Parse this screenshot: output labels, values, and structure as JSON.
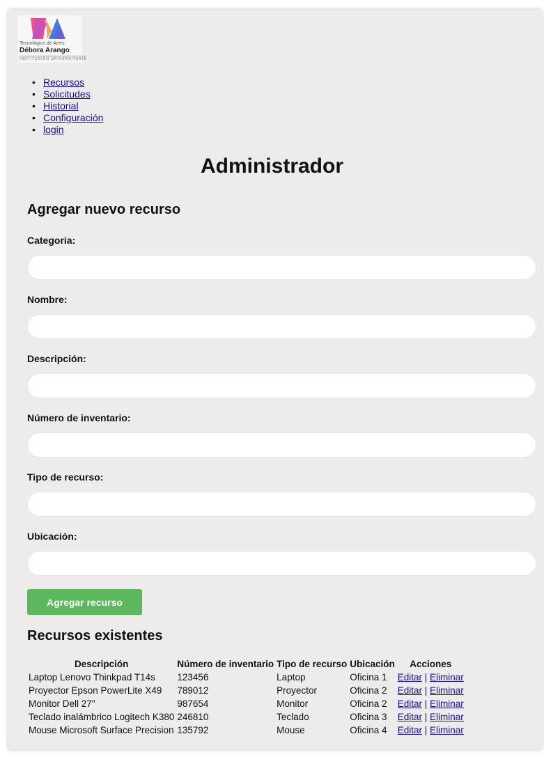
{
  "logo": {
    "line1": "Tecnológico de Artes",
    "line2": "Débora Arango",
    "line3": "INSTITUCIÓN UNIVERSITARIA"
  },
  "nav": {
    "items": [
      {
        "label": "Recursos"
      },
      {
        "label": "Solicitudes"
      },
      {
        "label": "Historial"
      },
      {
        "label": "Configuración"
      },
      {
        "label": "login"
      }
    ]
  },
  "page_title": "Administrador",
  "form": {
    "title": "Agregar nuevo recurso",
    "fields": [
      {
        "label": "Categoria:",
        "value": "",
        "placeholder": ""
      },
      {
        "label": "Nombre:",
        "value": "",
        "placeholder": ""
      },
      {
        "label": "Descripción:",
        "value": "",
        "placeholder": ""
      },
      {
        "label": "Número de inventario:",
        "value": "",
        "placeholder": ""
      },
      {
        "label": "Tipo de recurso:",
        "value": "",
        "placeholder": ""
      },
      {
        "label": "Ubicación:",
        "value": "",
        "placeholder": ""
      }
    ],
    "submit_label": "Agregar recurso"
  },
  "resources": {
    "title": "Recursos existentes",
    "columns": [
      "Descripción",
      "Número de inventario",
      "Tipo de recurso",
      "Ubicación",
      "Acciones"
    ],
    "edit_label": "Editar",
    "separator": "|",
    "delete_label": "Eliminar",
    "rows": [
      {
        "descripcion": "Laptop Lenovo Thinkpad T14s",
        "inventario": "123456",
        "tipo": "Laptop",
        "ubicacion": "Oficina 1"
      },
      {
        "descripcion": "Proyector Epson PowerLite X49",
        "inventario": "789012",
        "tipo": "Proyector",
        "ubicacion": "Oficina 2"
      },
      {
        "descripcion": "Monitor Dell 27\"",
        "inventario": "987654",
        "tipo": "Monitor",
        "ubicacion": "Oficina 2"
      },
      {
        "descripcion": "Teclado inalámbrico Logitech K380",
        "inventario": "246810",
        "tipo": "Teclado",
        "ubicacion": "Oficina 3"
      },
      {
        "descripcion": "Mouse Microsoft Surface Precision",
        "inventario": "135792",
        "tipo": "Mouse",
        "ubicacion": "Oficina 4"
      }
    ]
  },
  "colors": {
    "background": "#edebeb",
    "link": "#1a0dab",
    "button": "#5cb85c"
  }
}
